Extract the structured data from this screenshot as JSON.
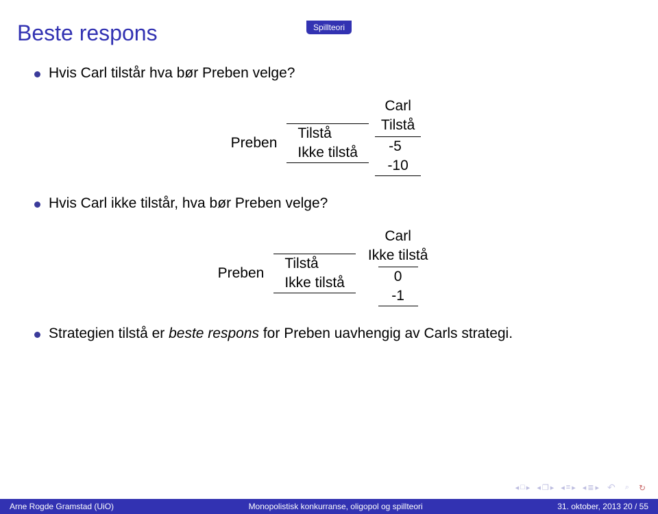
{
  "section_tab": "Spillteori",
  "title": "Beste respons",
  "bullets": {
    "b1": "Hvis Carl tilstår hva bør Preben velge?",
    "b2": "Hvis Carl ikke tilstår, hva bør Preben velge?",
    "b3_part1": "Strategien tilstå er ",
    "b3_italic": "beste respons",
    "b3_part2": " for Preben uavhengig av Carls strategi."
  },
  "labels": {
    "preben": "Preben",
    "carl": "Carl",
    "tilsta": "Tilstå",
    "ikke_tilsta": "Ikke tilstå"
  },
  "table1": {
    "col_header": "Tilstå",
    "row1_label": "Tilstå",
    "row1_val": "-5",
    "row2_label": "Ikke tilstå",
    "row2_val": "-10"
  },
  "table2": {
    "col_header": "Ikke tilstå",
    "row1_label": "Tilstå",
    "row1_val": "0",
    "row2_label": "Ikke tilstå",
    "row2_val": "-1"
  },
  "footer": {
    "left": "Arne Rogde Gramstad (UiO)",
    "center": "Monopolistisk konkurranse, oligopol og spillteori",
    "right": "31. oktober, 2013     20 / 55"
  }
}
